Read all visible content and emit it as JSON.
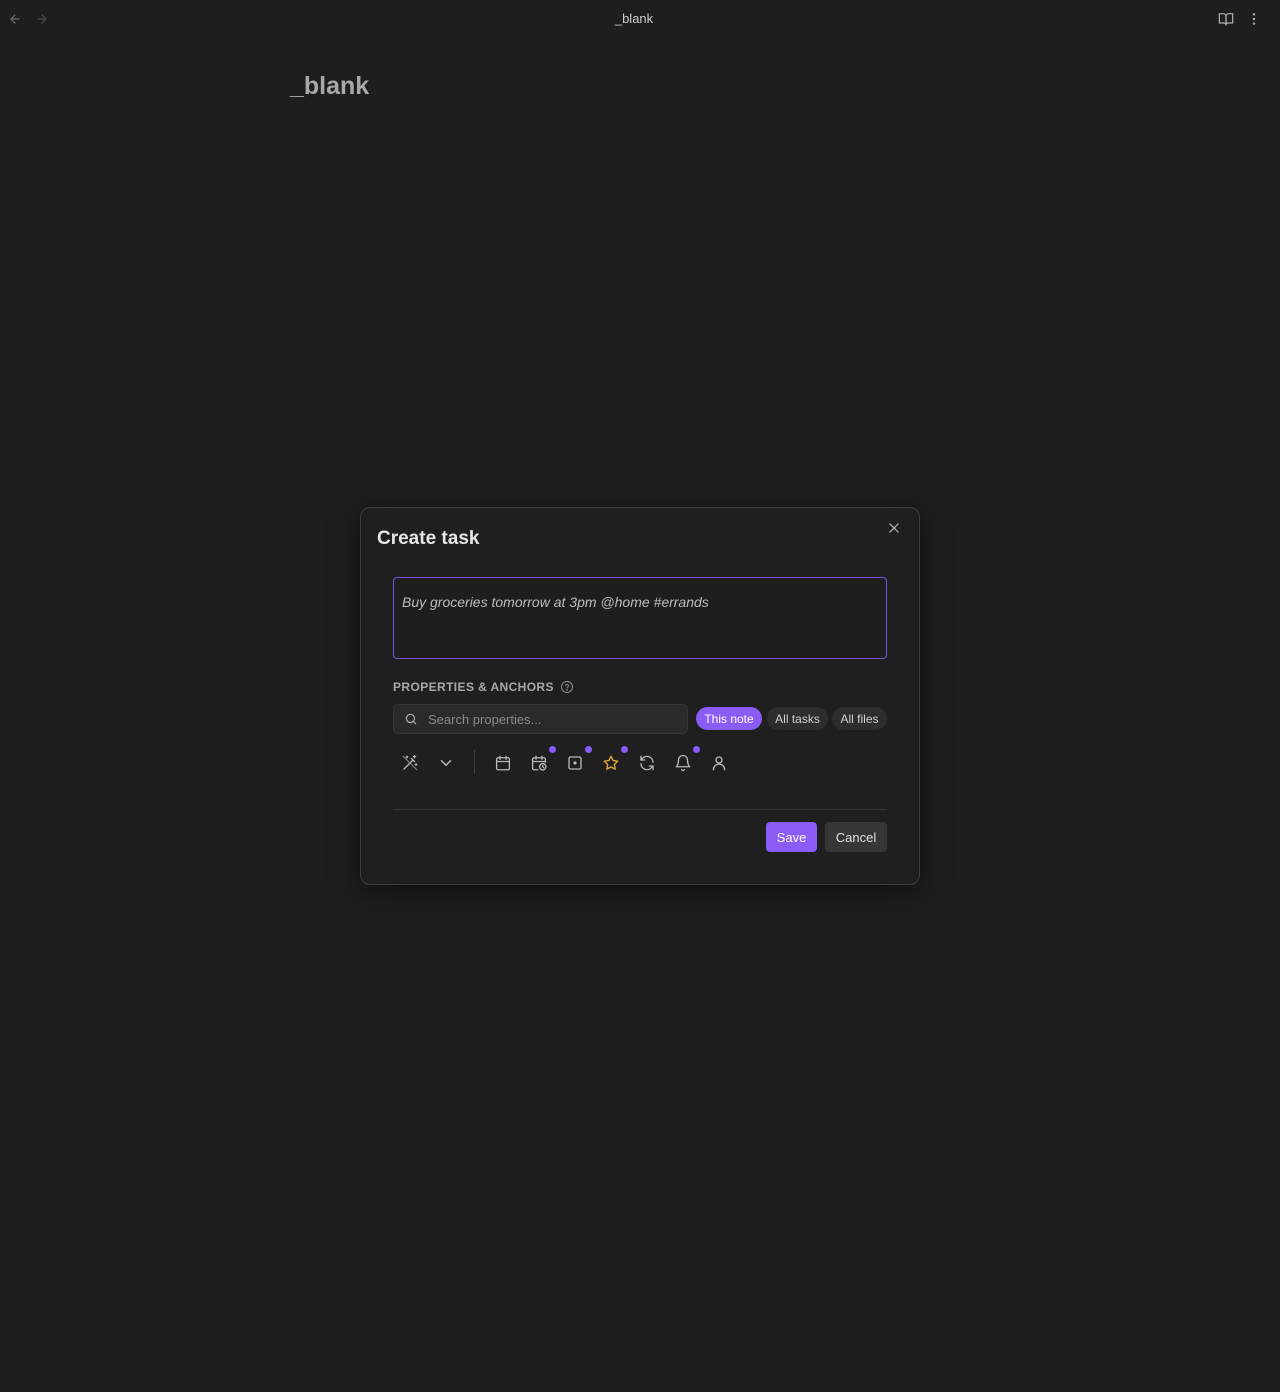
{
  "window": {
    "tab_title": "_blank",
    "icons": {
      "back": "arrow-left-icon",
      "forward": "arrow-right-icon",
      "reading_view": "book-open-icon",
      "more": "more-vertical-icon"
    }
  },
  "note": {
    "title": "_blank"
  },
  "modal": {
    "title": "Create task",
    "task_input_value": "Buy groceries tomorrow at 3pm @home #errands",
    "section_label": "PROPERTIES & ANCHORS",
    "search_placeholder": "Search properties...",
    "scope_pills": [
      "This note",
      "All tasks",
      "All files"
    ],
    "active_scope": "This note",
    "toolbar_icons": [
      {
        "name": "magic-wand-icon",
        "has_dot": false
      },
      {
        "name": "chevron-down-icon",
        "has_dot": false
      },
      {
        "name": "calendar-icon",
        "has_dot": false
      },
      {
        "name": "calendar-clock-icon",
        "has_dot": true
      },
      {
        "name": "square-dot-icon",
        "has_dot": true
      },
      {
        "name": "star-icon",
        "has_dot": true
      },
      {
        "name": "refresh-icon",
        "has_dot": false
      },
      {
        "name": "bell-icon",
        "has_dot": true
      },
      {
        "name": "user-icon",
        "has_dot": false
      }
    ],
    "save_label": "Save",
    "cancel_label": "Cancel"
  },
  "colors": {
    "background": "#1e1e1e",
    "accent": "#8a5cf5",
    "star": "#e5a53a"
  }
}
